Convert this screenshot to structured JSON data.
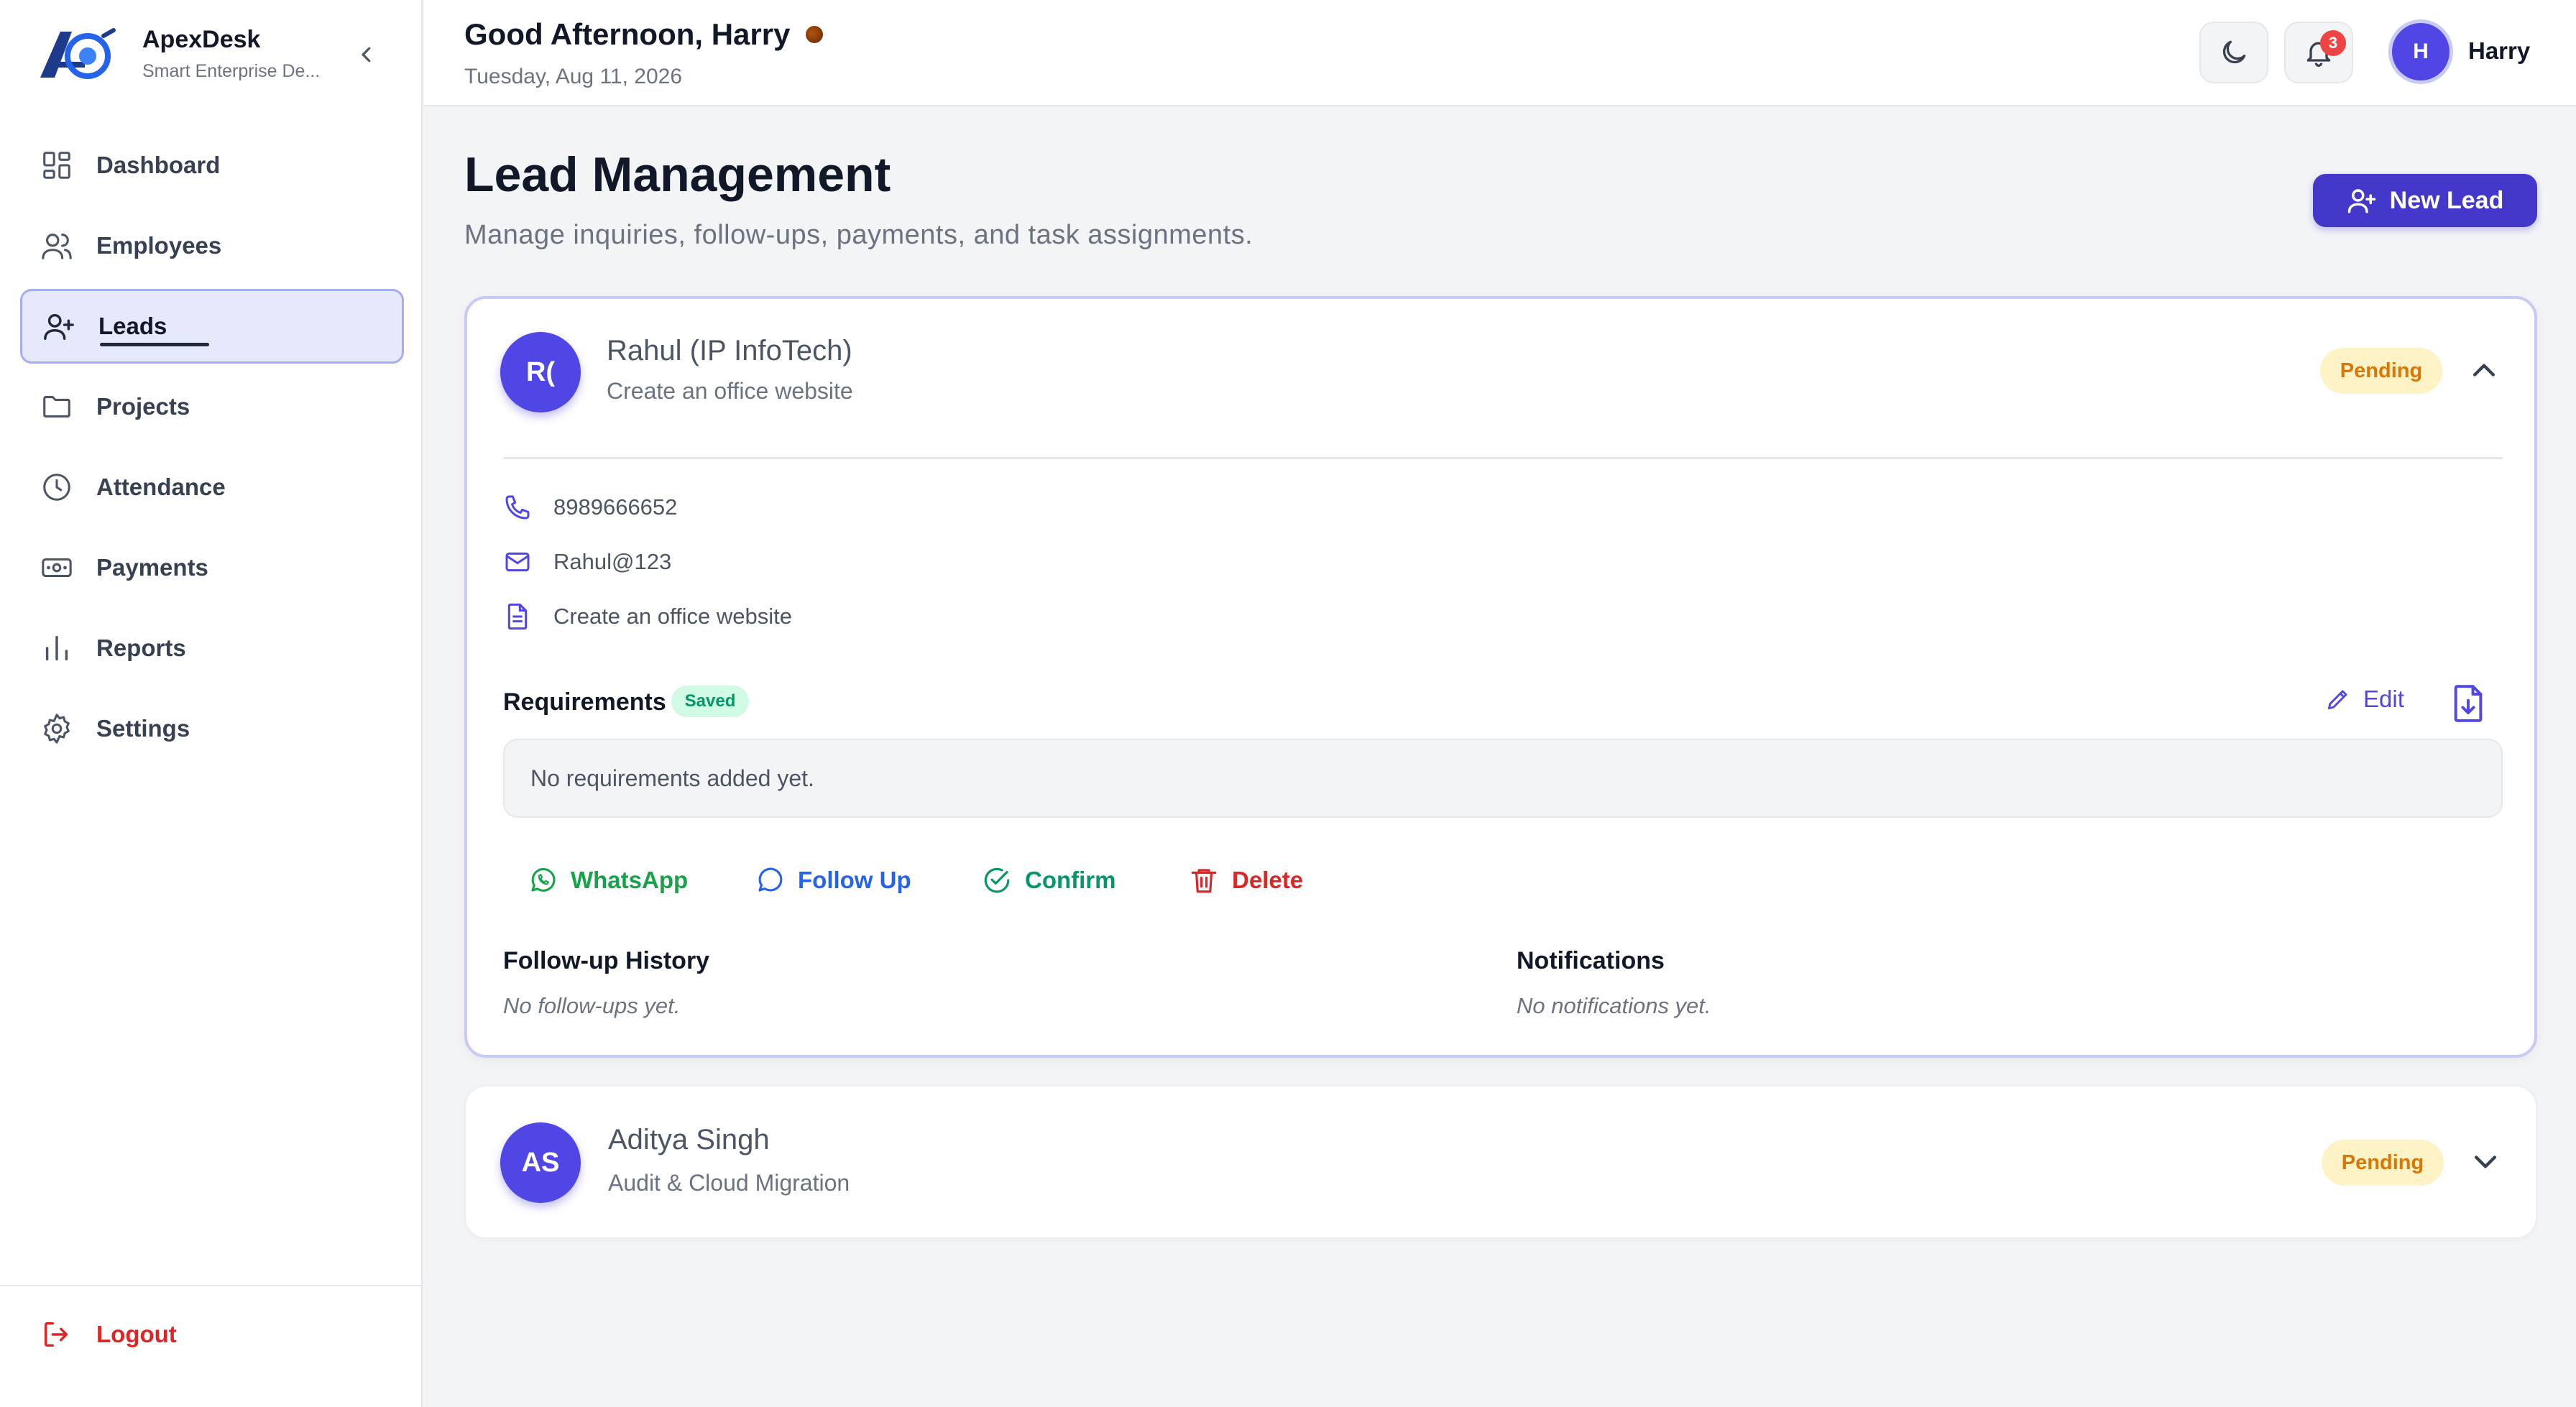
{
  "brand": {
    "name": "ApexDesk",
    "tagline": "Smart Enterprise De..."
  },
  "sidebar": {
    "items": [
      {
        "label": "Dashboard",
        "icon": "dashboard-icon"
      },
      {
        "label": "Employees",
        "icon": "users-icon"
      },
      {
        "label": "Leads",
        "icon": "user-plus-icon",
        "active": true
      },
      {
        "label": "Projects",
        "icon": "folder-icon"
      },
      {
        "label": "Attendance",
        "icon": "clock-icon"
      },
      {
        "label": "Payments",
        "icon": "banknote-icon"
      },
      {
        "label": "Reports",
        "icon": "bar-chart-icon"
      },
      {
        "label": "Settings",
        "icon": "gear-icon"
      }
    ],
    "logout_label": "Logout"
  },
  "header": {
    "greeting": "Good Afternoon, Harry",
    "date": "Tuesday, Aug 11, 2026",
    "notification_count": "3",
    "user_initial": "H",
    "user_name": "Harry"
  },
  "page": {
    "title": "Lead Management",
    "subtitle": "Manage inquiries, follow-ups, payments, and task assignments.",
    "new_lead_label": "New Lead"
  },
  "leads": [
    {
      "initials": "R(",
      "name": "Rahul (IP InfoTech)",
      "description": "Create an office website",
      "status": "Pending",
      "phone": "8989666652",
      "email": "Rahul@123",
      "note": "Create an office website",
      "requirements_label": "Requirements",
      "saved_label": "Saved",
      "edit_label": "Edit",
      "requirements_text": "No requirements added yet.",
      "actions": {
        "whatsapp": "WhatsApp",
        "follow_up": "Follow Up",
        "confirm": "Confirm",
        "delete": "Delete"
      },
      "followup_title": "Follow-up History",
      "followup_empty": "No follow-ups yet.",
      "notifications_title": "Notifications",
      "notifications_empty": "No notifications yet."
    },
    {
      "initials": "AS",
      "name": "Aditya Singh",
      "description": "Audit & Cloud Migration",
      "status": "Pending"
    }
  ],
  "colors": {
    "accent": "#4f46e5",
    "pending": "#d97706",
    "whatsapp": "#16a34a",
    "followup": "#2563eb",
    "confirm": "#059669",
    "delete": "#dc2626"
  }
}
